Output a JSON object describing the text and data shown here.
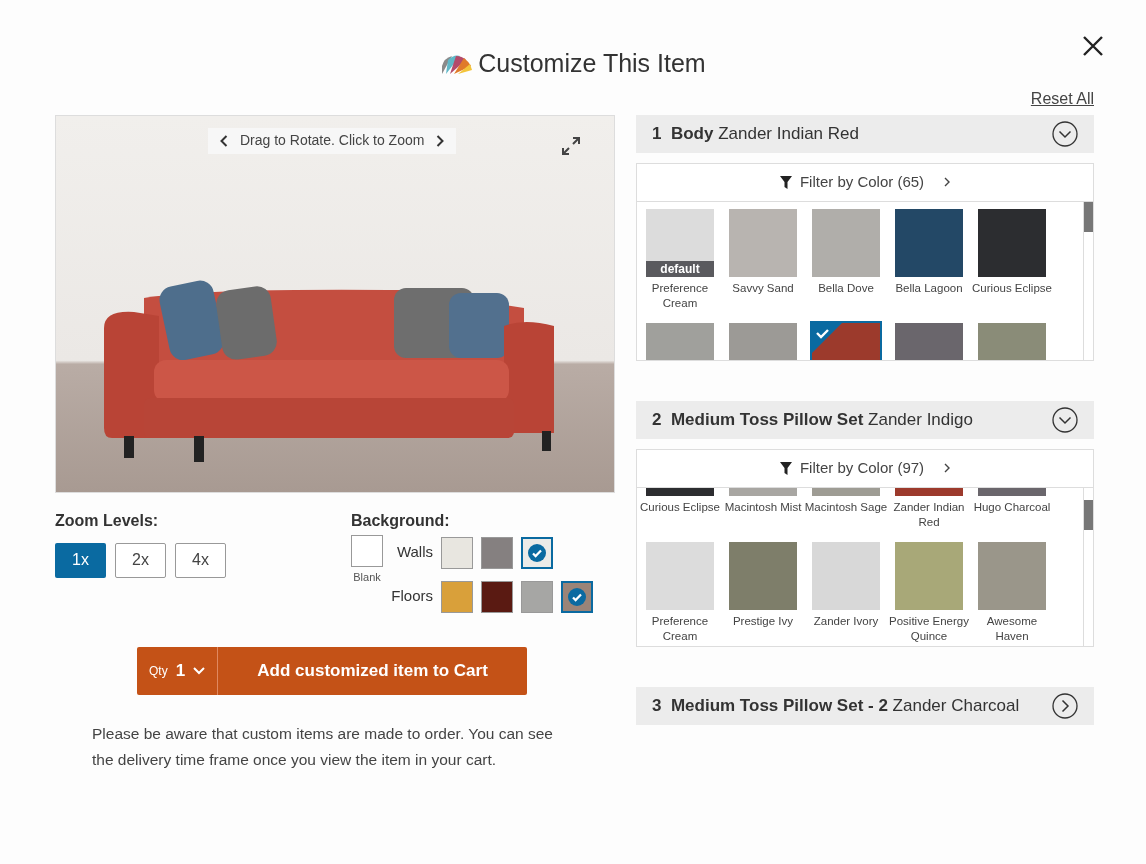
{
  "title": "Customize This Item",
  "reset_all": "Reset All",
  "viewer": {
    "hint": "Drag to Rotate. Click to Zoom"
  },
  "zoom": {
    "label": "Zoom Levels:",
    "levels": [
      {
        "label": "1x",
        "selected": true
      },
      {
        "label": "2x",
        "selected": false
      },
      {
        "label": "4x",
        "selected": false
      }
    ]
  },
  "background": {
    "label": "Background:",
    "blank": {
      "label": "Blank",
      "selected": false
    },
    "rows": [
      {
        "label": "Walls",
        "swatches": [
          {
            "color": "#e8e6e0",
            "selected": false
          },
          {
            "color": "#858080",
            "selected": false
          },
          {
            "color": "#ecebe8",
            "selected": true
          }
        ]
      },
      {
        "label": "Floors",
        "swatches": [
          {
            "color": "#d9a03a",
            "selected": false
          },
          {
            "color": "#5a1a12",
            "selected": false
          },
          {
            "color": "#a6a6a4",
            "selected": false
          },
          {
            "color": "#9a8478",
            "selected": true
          }
        ]
      }
    ]
  },
  "cart": {
    "qty_label": "Qty",
    "qty": "1",
    "button": "Add customized item to Cart"
  },
  "note": "Please be aware that custom items are made to order. You can see the delivery time frame once you view the item in your cart.",
  "sections": [
    {
      "number": "1",
      "name": "Body",
      "value": "Zander Indian Red",
      "expanded": true,
      "filter": "Filter by Color (65)",
      "scrolled": false,
      "swatches": [
        {
          "name": "Preference Cream",
          "color": "#dcdcdc",
          "selected": false,
          "badge": "default"
        },
        {
          "name": "Savvy Sand",
          "color": "#b8b4b0",
          "selected": false
        },
        {
          "name": "Bella Dove",
          "color": "#b0aeaa",
          "selected": false
        },
        {
          "name": "Bella Lagoon",
          "color": "#234866",
          "selected": false
        },
        {
          "name": "Curious Eclipse",
          "color": "#2c2d30",
          "selected": false
        },
        {
          "color": "#a0a09c",
          "selected": false
        },
        {
          "color": "#9c9a96",
          "selected": false
        },
        {
          "color": "#9c3a2c",
          "selected": true
        },
        {
          "color": "#6a666c",
          "selected": false
        },
        {
          "color": "#8a8c78",
          "selected": false
        }
      ]
    },
    {
      "number": "2",
      "name": "Medium Toss Pillow Set",
      "value": "Zander Indigo",
      "expanded": true,
      "filter": "Filter by Color (97)",
      "scrolled": true,
      "swatches": [
        {
          "name": "Curious Eclipse",
          "color": "#2c2d30",
          "selected": false
        },
        {
          "name": "Macintosh Mist",
          "color": "#a8a6a2",
          "selected": false
        },
        {
          "name": "Macintosh Sage",
          "color": "#9e9c94",
          "selected": false
        },
        {
          "name": "Zander Indian Red",
          "color": "#9c3a2c",
          "selected": false
        },
        {
          "name": "Hugo Charcoal",
          "color": "#6a666c",
          "selected": false
        },
        {
          "name": "Preference Cream",
          "color": "#dcdcdc",
          "selected": false
        },
        {
          "name": "Prestige Ivy",
          "color": "#7e7e6a",
          "selected": false
        },
        {
          "name": "Zander Ivory",
          "color": "#d8d8d8",
          "selected": false
        },
        {
          "name": "Positive Energy Quince",
          "color": "#a8a878",
          "selected": false
        },
        {
          "name": "Awesome Haven",
          "color": "#9a968a",
          "selected": false
        }
      ]
    },
    {
      "number": "3",
      "name": "Medium Toss Pillow Set - 2",
      "value": "Zander Charcoal",
      "expanded": false
    }
  ]
}
